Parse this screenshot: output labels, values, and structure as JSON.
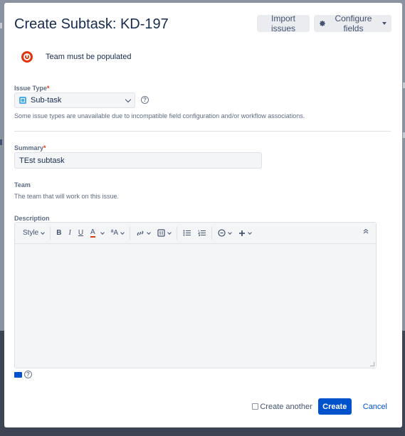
{
  "dialog": {
    "title": "Create Subtask: KD-197",
    "import_label": "Import issues",
    "configure_label": "Configure fields"
  },
  "error": {
    "message": "Team must be populated"
  },
  "issue_type": {
    "label": "Issue Type",
    "required_mark": "*",
    "value": "Sub-task",
    "help": "Some issue types are unavailable due to incompatible field configuration and/or workflow associations."
  },
  "summary": {
    "label": "Summary",
    "required_mark": "*",
    "value": "TEst subtask"
  },
  "team": {
    "label": "Team",
    "help": "The team that will work on this issue."
  },
  "description": {
    "label": "Description",
    "toolbar": {
      "style_label": "Style",
      "bold": "B",
      "italic": "I",
      "underline": "U",
      "color": "A",
      "size": "ªA"
    }
  },
  "footer": {
    "create_another_label": "Create another",
    "create_label": "Create",
    "cancel_label": "Cancel"
  },
  "colors": {
    "primary": "#0052cc",
    "error": "#de350b",
    "text": "#172b4d"
  }
}
